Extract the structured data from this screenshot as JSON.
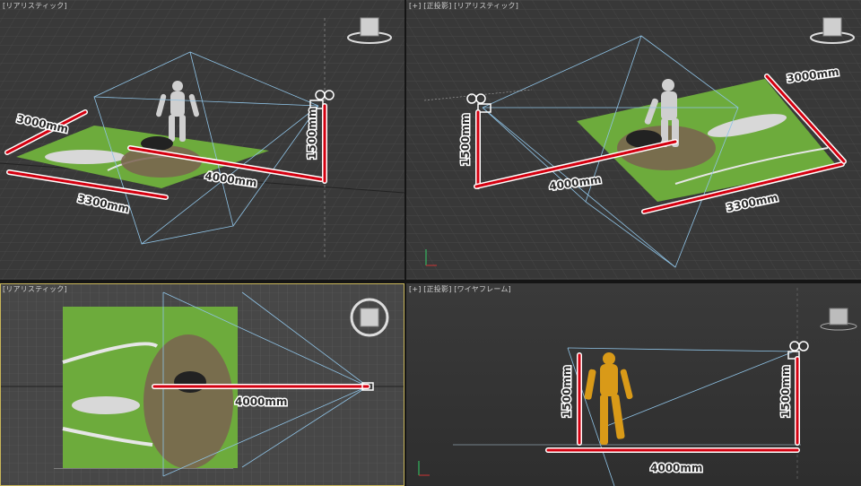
{
  "viewports": {
    "top_left": {
      "label": "[リアリスティック]"
    },
    "top_right": {
      "label": "[+] [正投影] [リアリスティック]"
    },
    "bottom_left": {
      "label": "[リアリスティック]"
    },
    "bottom_right": {
      "label": "[+] [正投影] [ワイヤフレーム]"
    }
  },
  "dimensions": {
    "width_3000": "3000mm",
    "length_3300": "3300mm",
    "distance_4000": "4000mm",
    "height_1500": "1500mm"
  },
  "colors": {
    "dimension_line": "#d40010",
    "frustum": "#8fc3e6",
    "grass": "#6dab3c",
    "active_border": "#c8b55a"
  }
}
